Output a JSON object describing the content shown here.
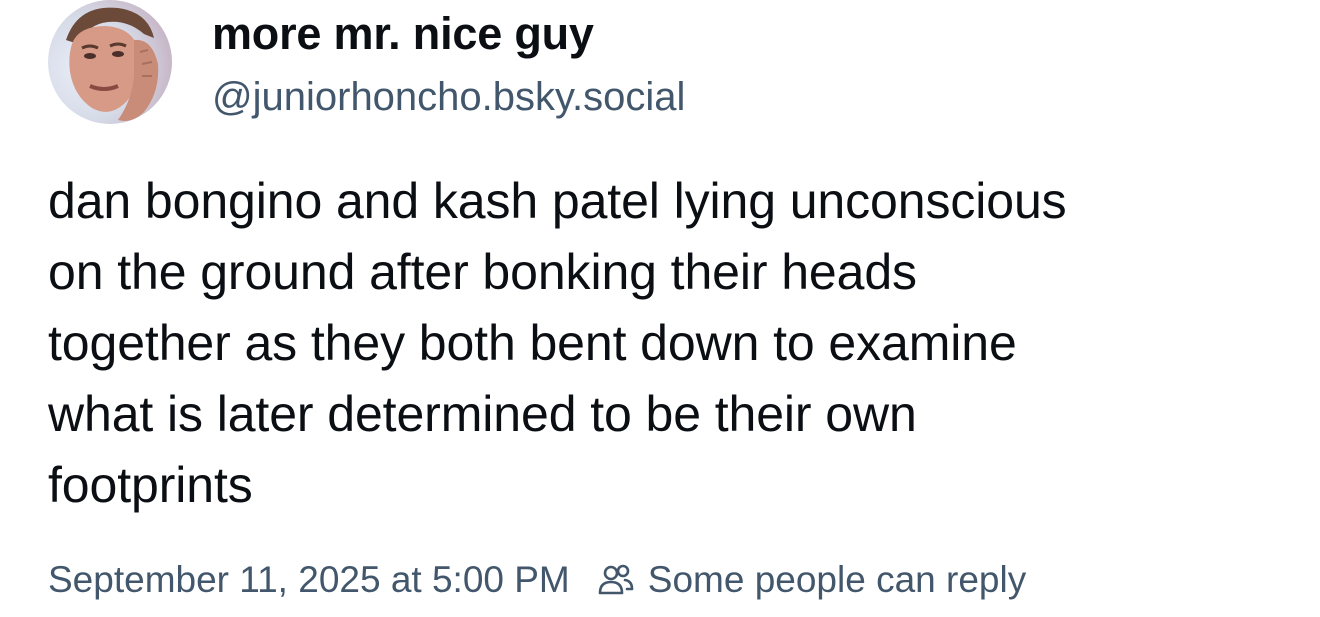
{
  "author": {
    "display_name": "more mr. nice guy",
    "handle": "@juniorhoncho.bsky.social",
    "avatar_icon": "avatar-photo"
  },
  "post": {
    "text": "dan bongino and kash patel lying unconscious\non the ground after bonking their heads\ntogether as they both bent down to examine\nwhat is later determined to be their own\nfootprints"
  },
  "meta": {
    "timestamp": "September 11, 2025 at 5:00 PM",
    "reply_setting_icon": "people-icon",
    "reply_setting_label": "Some people can reply"
  },
  "colors": {
    "text_primary": "#0b0f14",
    "text_secondary": "#42576c",
    "background": "#ffffff"
  }
}
